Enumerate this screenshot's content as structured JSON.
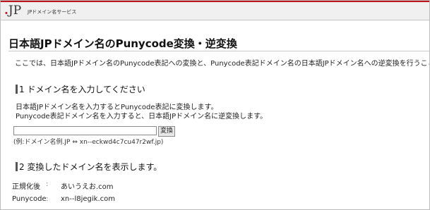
{
  "header": {
    "logo_text": "JP",
    "logo_dot": ".",
    "logo_subtitle": "JPドメイン名サービス"
  },
  "page_title": "日本語JPドメイン名のPunycode変換・逆変換",
  "intro": "ここでは、日本語JPドメイン名のPunycode表記への変換と、Punycode表記ドメイン名の日本語JPドメイン名への逆変換を行うことがで",
  "section1": {
    "heading": "1 ドメイン名を入力してください",
    "desc_line1": "日本語JPドメイン名を入力するとPunycode表記に変換します。",
    "desc_line2": "Punycode表記ドメイン名を入力すると、日本語JPドメイン名に逆変換します。",
    "input_value": "",
    "input_placeholder": "",
    "button_label": "変換",
    "example": "(例:ドメイン名例.JP ⇔ xn--eckwd4c7cu47r2wf.jp)"
  },
  "section2": {
    "heading": "2 変換したドメイン名を表示します。",
    "rows": [
      {
        "label": "正規化後",
        "separator": ":",
        "value": "あいうえお.com"
      },
      {
        "label": "Punycode",
        "separator": ":",
        "value": "xn--l8jegik.com"
      }
    ]
  },
  "colors": {
    "accent_red": "#c0141b",
    "header_bg": "#f0f0f0"
  }
}
